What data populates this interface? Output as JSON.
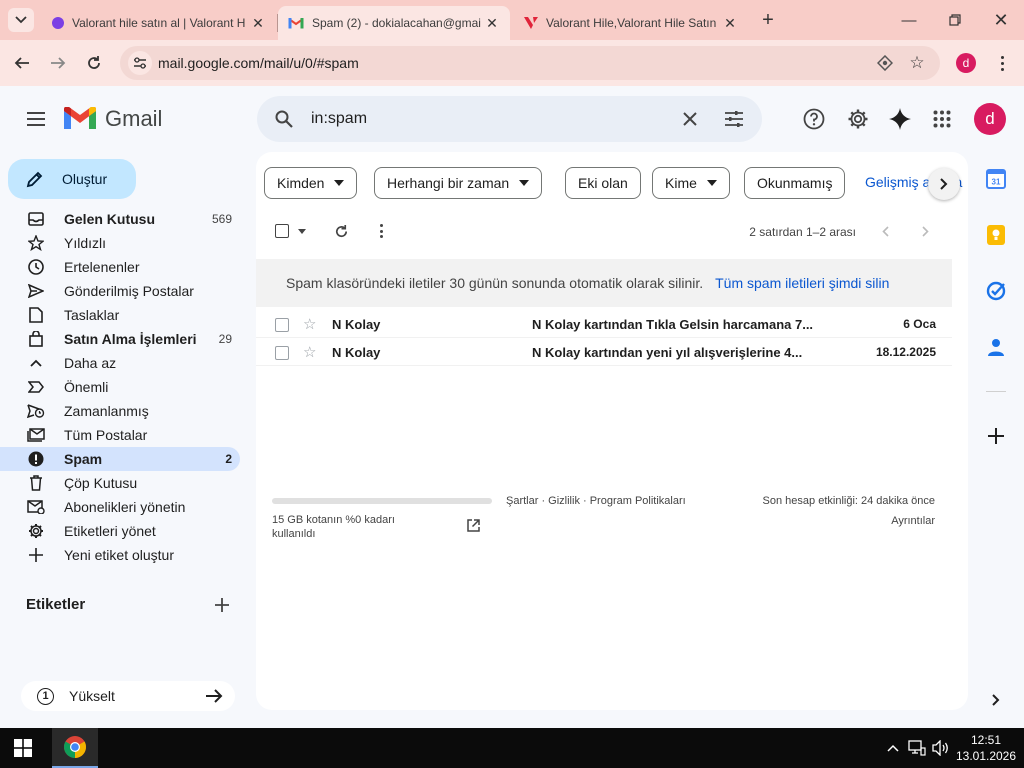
{
  "browser": {
    "tabs": [
      {
        "title": "Valorant hile satın al | Valorant H"
      },
      {
        "title": "Spam (2) - dokialacahan@gmai"
      },
      {
        "title": "Valorant Hile,Valorant Hile Satın"
      }
    ],
    "url": "mail.google.com/mail/u/0/#spam",
    "profile_initial": "d",
    "colors": {
      "tab_strip": "#f8cdc8",
      "active_tab": "#fbe6e3"
    }
  },
  "gmail": {
    "logo_text": "Gmail",
    "search_query": "in:spam",
    "account_initial": "d",
    "compose_label": "Oluştur",
    "nav_items": [
      {
        "label": "Gelen Kutusu",
        "count": "569",
        "icon": "inbox-icon"
      },
      {
        "label": "Yıldızlı",
        "count": "",
        "icon": "star-icon"
      },
      {
        "label": "Ertelenenler",
        "count": "",
        "icon": "clock-icon"
      },
      {
        "label": "Gönderilmiş Postalar",
        "count": "",
        "icon": "send-icon"
      },
      {
        "label": "Taslaklar",
        "count": "",
        "icon": "draft-icon"
      },
      {
        "label": "Satın Alma İşlemleri",
        "count": "29",
        "icon": "shopping-bag-icon"
      },
      {
        "label": "Daha az",
        "count": "",
        "icon": "chevron-up-icon"
      },
      {
        "label": "Önemli",
        "count": "",
        "icon": "important-icon"
      },
      {
        "label": "Zamanlanmış",
        "count": "",
        "icon": "scheduled-send-icon"
      },
      {
        "label": "Tüm Postalar",
        "count": "",
        "icon": "all-mail-icon"
      },
      {
        "label": "Spam",
        "count": "2",
        "icon": "spam-icon"
      },
      {
        "label": "Çöp Kutusu",
        "count": "",
        "icon": "trash-icon"
      },
      {
        "label": "Abonelikleri yönetin",
        "count": "",
        "icon": "manage-subscriptions-icon"
      },
      {
        "label": "Etiketleri yönet",
        "count": "",
        "icon": "gear-icon"
      },
      {
        "label": "Yeni etiket oluştur",
        "count": "",
        "icon": "plus-icon"
      }
    ],
    "labels_heading": "Etiketler",
    "upgrade_label": "Yükselt",
    "filter_chips": [
      {
        "label": "Kimden",
        "dropdown": true
      },
      {
        "label": "Herhangi bir zaman",
        "dropdown": true
      },
      {
        "label": "Eki olan",
        "dropdown": false
      },
      {
        "label": "Kime",
        "dropdown": true
      },
      {
        "label": "Okunmamış",
        "dropdown": false
      }
    ],
    "advanced_search_label": "Gelişmiş arama",
    "pagination_text": "2 satırdan 1–2 arası",
    "spam_notice": "Spam klasöründeki iletiler 30 günün sonunda otomatik olarak silinir.",
    "delete_all_spam_label": "Tüm spam iletileri şimdi silin",
    "emails": [
      {
        "sender": "N Kolay",
        "subject": "N Kolay kartından Tıkla Gelsin harcamana 7...",
        "date": "6 Oca"
      },
      {
        "sender": "N Kolay",
        "subject": "N Kolay kartından yeni yıl alışverişlerine 4...",
        "date": "18.12.2025"
      }
    ],
    "footer": {
      "storage_text": "15 GB kotanın %0 kadarı kullanıldı",
      "storage_fraction": 0,
      "links": "Şartlar · Gizlilik · Program Politikaları",
      "last_activity": "Son hesap etkinliği: 24 dakika önce",
      "details_label": "Ayrıntılar"
    }
  },
  "taskbar": {
    "time": "12:51",
    "date": "13.01.2026"
  }
}
